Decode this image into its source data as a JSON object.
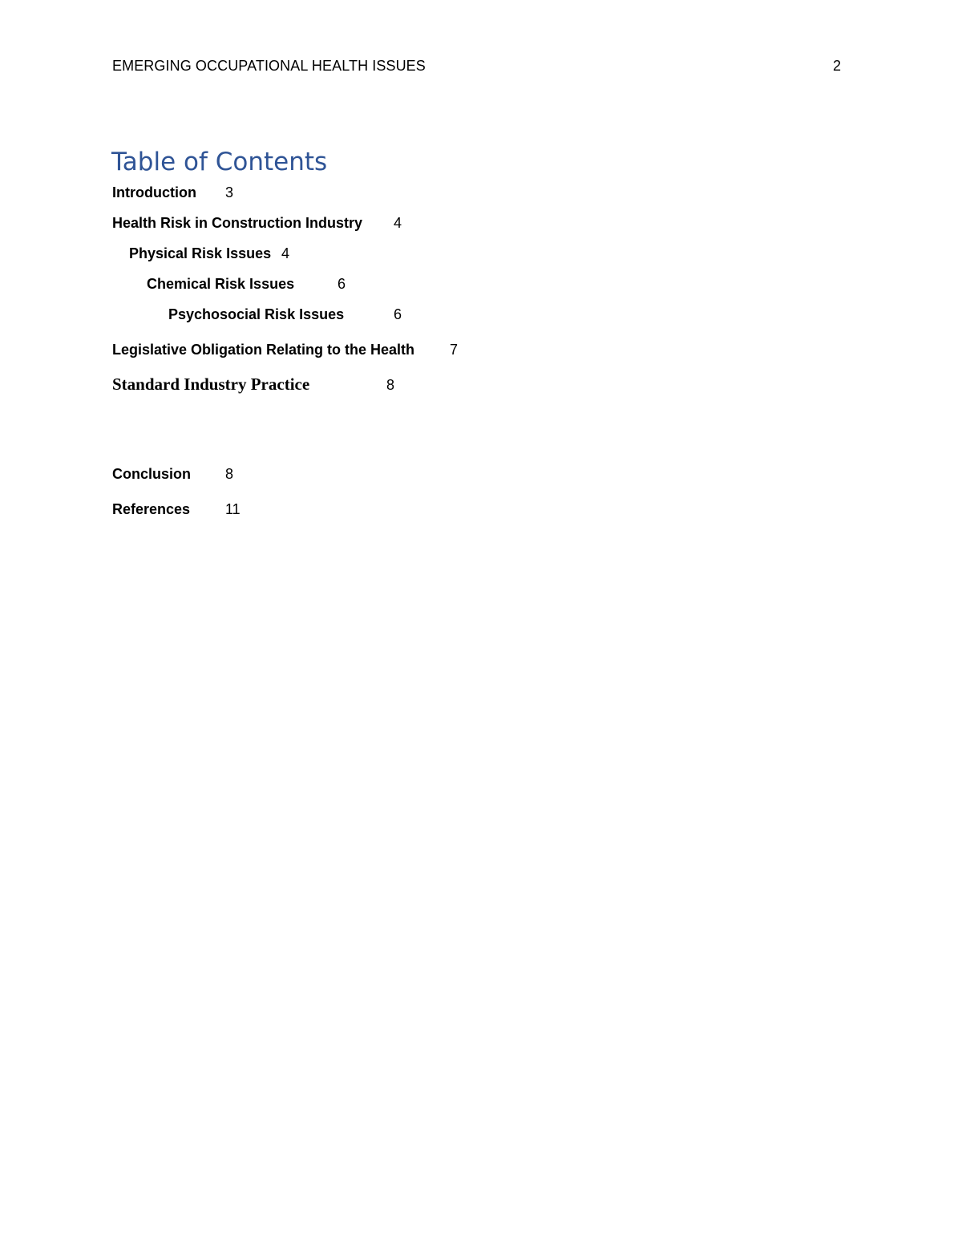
{
  "header": {
    "running_head": "EMERGING OCCUPATIONAL HEALTH ISSUES",
    "page_number": "2"
  },
  "toc": {
    "heading": "Table of Contents",
    "heading_color": "#2f5496",
    "entries": [
      {
        "title": "Introduction",
        "page": "3",
        "level": 1
      },
      {
        "title": "Health Risk in Construction Industry",
        "page": "4",
        "level": 1
      },
      {
        "title": "Physical Risk Issues",
        "page": "4",
        "level": 2
      },
      {
        "title": "Chemical Risk Issues",
        "page": "6",
        "level": 3
      },
      {
        "title": "Psychosocial Risk Issues",
        "page": "6",
        "level": 4
      },
      {
        "title": "Legislative Obligation Relating to the Health",
        "page": "7",
        "level": 1
      },
      {
        "title": "Standard Industry Practice",
        "page": "8",
        "level": 1
      },
      {
        "title": "Conclusion",
        "page": "8",
        "level": 1
      },
      {
        "title": "References",
        "page": "11",
        "level": 1
      }
    ]
  }
}
